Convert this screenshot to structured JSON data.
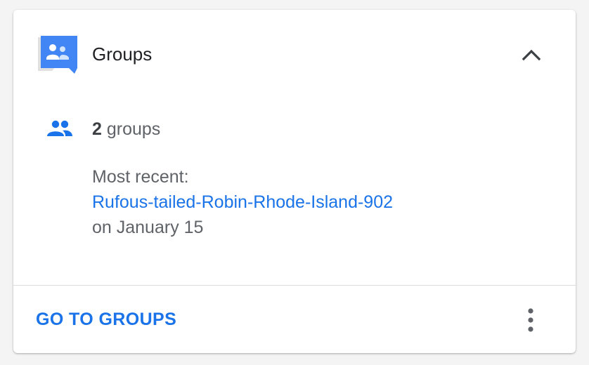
{
  "card": {
    "title": "Groups",
    "header_icon": "google-groups-logo-icon",
    "collapse_icon": "chevron-up-icon"
  },
  "summary": {
    "icon": "people-icon",
    "count": "2",
    "count_suffix": " groups"
  },
  "recent": {
    "label": "Most recent:",
    "group_name": "Rufous-tailed-Robin-Rhode-Island-902",
    "date": "on January 15"
  },
  "footer": {
    "action_label": "GO TO GROUPS",
    "more_icon": "more-vert-icon"
  },
  "colors": {
    "accent": "#1a73e8",
    "text_primary": "#202124",
    "text_secondary": "#5f6368",
    "divider": "#dadce0"
  }
}
